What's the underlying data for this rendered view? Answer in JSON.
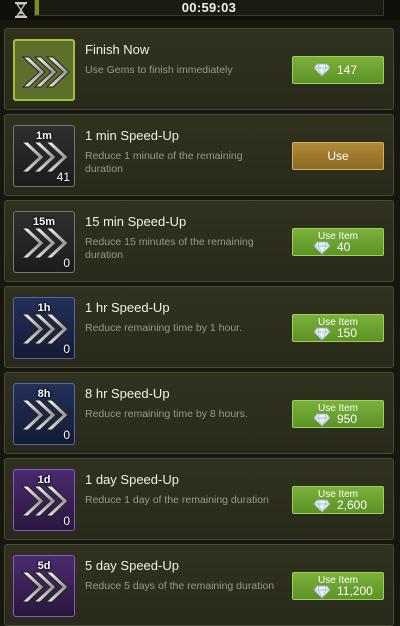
{
  "header": {
    "timer": "00:59:03",
    "hourglass_icon": "hourglass-icon"
  },
  "items": [
    {
      "title": "Finish Now",
      "desc": "Use Gems to finish immediately",
      "badge": "",
      "count": "",
      "button_label": "",
      "price": "147",
      "tier": "active",
      "button_type": "gem"
    },
    {
      "title": "1 min Speed-Up",
      "desc": "Reduce 1 minute of the remaining duration",
      "badge": "1m",
      "count": "41",
      "button_label": "Use",
      "price": "",
      "tier": "gray",
      "button_type": "use"
    },
    {
      "title": "15 min Speed-Up",
      "desc": "Reduce 15 minutes of the remaining duration",
      "badge": "15m",
      "count": "0",
      "button_label": "Use Item",
      "price": "40",
      "tier": "gray",
      "button_type": "gem-item"
    },
    {
      "title": "1 hr Speed-Up",
      "desc": "Reduce remaining time by 1 hour.",
      "badge": "1h",
      "count": "0",
      "button_label": "Use Item",
      "price": "150",
      "tier": "blue",
      "button_type": "gem-item"
    },
    {
      "title": "8 hr Speed-Up",
      "desc": "Reduce remaining time by 8 hours.",
      "badge": "8h",
      "count": "0",
      "button_label": "Use Item",
      "price": "950",
      "tier": "blue",
      "button_type": "gem-item"
    },
    {
      "title": "1 day Speed-Up",
      "desc": "Reduce 1 day of the remaining duration",
      "badge": "1d",
      "count": "0",
      "button_label": "Use Item",
      "price": "2,600",
      "tier": "purple",
      "button_type": "gem-item"
    },
    {
      "title": "5 day Speed-Up",
      "desc": "Reduce 5 days of the remaining duration",
      "badge": "5d",
      "count": "",
      "button_label": "Use Item",
      "price": "11,200",
      "tier": "purple",
      "button_type": "gem-item"
    }
  ],
  "icons": {
    "speedup": "triple-arrow-speedup-icon",
    "gem": "gem-icon"
  },
  "colors": {
    "green_button": "#6aa52e",
    "gold_button": "#a07a2c",
    "active_border": "#9fc23a"
  }
}
